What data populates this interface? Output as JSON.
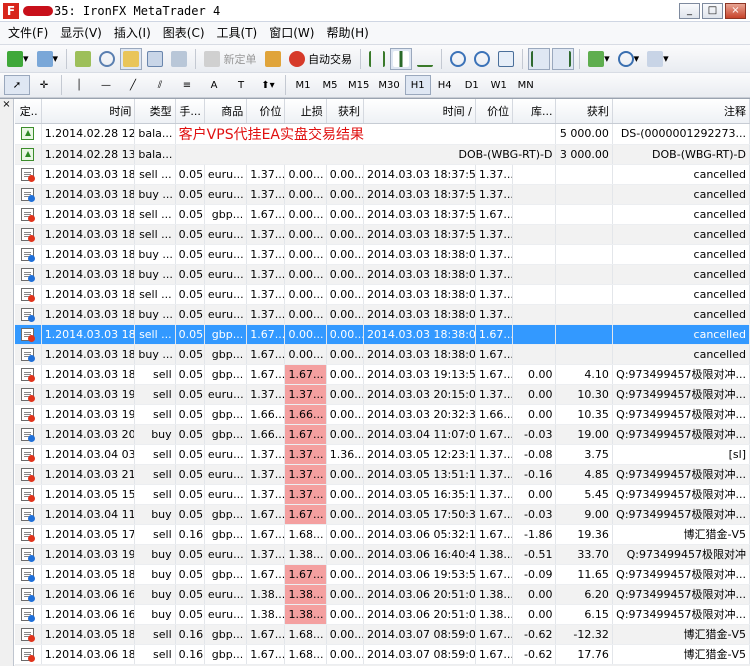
{
  "window": {
    "title": "35: IronFX MetaTrader 4",
    "icon_letter": "F",
    "min_label": "_",
    "max_label": "□",
    "close_label": "×"
  },
  "menu": [
    "文件(F)",
    "显示(V)",
    "插入(I)",
    "图表(C)",
    "工具(T)",
    "窗口(W)",
    "帮助(H)"
  ],
  "toolbar": {
    "new_order_label": "新定单",
    "autotrade_label": "自动交易"
  },
  "timeframes": [
    "M1",
    "M5",
    "M15",
    "M30",
    "H1",
    "H4",
    "D1",
    "W1",
    "MN"
  ],
  "active_timeframe": "H1",
  "side_close_label": "×",
  "table": {
    "headers": [
      "定..",
      "时间",
      "类型",
      "手...",
      "商品",
      "价位",
      "止损",
      "获利",
      "时间 /",
      "价位",
      "库...",
      "获利",
      "注释"
    ],
    "rows": [
      {
        "kind": "dep",
        "c": [
          "",
          "1.2014.02.28 12:...",
          "bala...",
          "",
          "",
          "",
          "",
          "",
          "",
          "",
          "",
          "5 000.00",
          "DS-(0000001292273..."
        ],
        "banner": "客户VPS代挂EA实盘交易结果",
        "banner_right": "DS-(0000001292273 25)-C"
      },
      {
        "kind": "dep",
        "c": [
          "",
          "1.2014.02.28 13:...",
          "bala...",
          "",
          "",
          "",
          "",
          "",
          "",
          "",
          "",
          "3 000.00",
          "DOB-(WBG-RT)-D"
        ],
        "banner": "",
        "banner_right": "DOB-(WBG-RT)-D"
      },
      {
        "kind": "red",
        "c": [
          "",
          "1.2014.03.03 18:...",
          "sell ...",
          "0.05",
          "euru...",
          "1.37...",
          "0.00...",
          "0.00...",
          "2014.03.03 18:37:50",
          "1.37...",
          "",
          "",
          "cancelled"
        ]
      },
      {
        "kind": "blue",
        "c": [
          "",
          "1.2014.03.03 18:...",
          "buy ...",
          "0.05",
          "euru...",
          "1.37...",
          "0.00...",
          "0.00...",
          "2014.03.03 18:37:52",
          "1.37...",
          "",
          "",
          "cancelled"
        ]
      },
      {
        "kind": "red",
        "c": [
          "",
          "1.2014.03.03 18:...",
          "sell ...",
          "0.05",
          "gbp...",
          "1.67...",
          "0.00...",
          "0.00...",
          "2014.03.03 18:37:54",
          "1.67...",
          "",
          "",
          "cancelled"
        ]
      },
      {
        "kind": "red",
        "c": [
          "",
          "1.2014.03.03 18:...",
          "sell ...",
          "0.05",
          "euru...",
          "1.37...",
          "0.00...",
          "0.00...",
          "2014.03.03 18:37:59",
          "1.37...",
          "",
          "",
          "cancelled"
        ]
      },
      {
        "kind": "blue",
        "c": [
          "",
          "1.2014.03.03 18:...",
          "buy ...",
          "0.05",
          "euru...",
          "1.37...",
          "0.00...",
          "0.00...",
          "2014.03.03 18:38:01",
          "1.37...",
          "",
          "",
          "cancelled"
        ]
      },
      {
        "kind": "blue",
        "c": [
          "",
          "1.2014.03.03 18:...",
          "buy ...",
          "0.05",
          "euru...",
          "1.37...",
          "0.00...",
          "0.00...",
          "2014.03.03 18:38:04",
          "1.37...",
          "",
          "",
          "cancelled"
        ]
      },
      {
        "kind": "red",
        "c": [
          "",
          "1.2014.03.03 18:...",
          "sell ...",
          "0.05",
          "euru...",
          "1.37...",
          "0.00...",
          "0.00...",
          "2014.03.03 18:38:05",
          "1.37...",
          "",
          "",
          "cancelled"
        ]
      },
      {
        "kind": "blue",
        "c": [
          "",
          "1.2014.03.03 18:...",
          "buy ...",
          "0.05",
          "euru...",
          "1.37...",
          "0.00...",
          "0.00...",
          "2014.03.03 18:38:06",
          "1.37...",
          "",
          "",
          "cancelled"
        ]
      },
      {
        "kind": "red",
        "sel": true,
        "c": [
          "",
          "1.2014.03.03 18:...",
          "sell ...",
          "0.05",
          "gbp...",
          "1.67...",
          "0.00...",
          "0.00...",
          "2014.03.03 18:38:08",
          "1.67...",
          "",
          "",
          "cancelled"
        ]
      },
      {
        "kind": "blue",
        "c": [
          "",
          "1.2014.03.03 18:...",
          "buy ...",
          "0.05",
          "gbp...",
          "1.67...",
          "0.00...",
          "0.00...",
          "2014.03.03 18:38:09",
          "1.67...",
          "",
          "",
          "cancelled"
        ]
      },
      {
        "kind": "red",
        "sl": true,
        "c": [
          "",
          "1.2014.03.03 18:...",
          "sell",
          "0.05",
          "gbp...",
          "1.67...",
          "1.67...",
          "0.00...",
          "2014.03.03 19:13:57",
          "1.67...",
          "0.00",
          "4.10",
          "Q:973499457极限对冲..."
        ]
      },
      {
        "kind": "red",
        "sl": true,
        "c": [
          "",
          "1.2014.03.03 19:...",
          "sell",
          "0.05",
          "euru...",
          "1.37...",
          "1.37...",
          "0.00...",
          "2014.03.03 20:15:01",
          "1.37...",
          "0.00",
          "10.30",
          "Q:973499457极限对冲..."
        ]
      },
      {
        "kind": "red",
        "sl": true,
        "c": [
          "",
          "1.2014.03.03 19:...",
          "sell",
          "0.05",
          "gbp...",
          "1.66...",
          "1.66...",
          "0.00...",
          "2014.03.03 20:32:31",
          "1.66...",
          "0.00",
          "10.35",
          "Q:973499457极限对冲..."
        ]
      },
      {
        "kind": "blue",
        "sl": true,
        "c": [
          "",
          "1.2014.03.03 20:...",
          "buy",
          "0.05",
          "gbp...",
          "1.66...",
          "1.67...",
          "0.00...",
          "2014.03.04 11:07:06",
          "1.67...",
          "-0.03",
          "19.00",
          "Q:973499457极限对冲..."
        ]
      },
      {
        "kind": "red",
        "sl": true,
        "c": [
          "",
          "1.2014.03.04 03:...",
          "sell",
          "0.05",
          "euru...",
          "1.37...",
          "1.37...",
          "1.36...",
          "2014.03.05 12:23:11",
          "1.37...",
          "-0.08",
          "3.75",
          "[sl]"
        ]
      },
      {
        "kind": "red",
        "sl": true,
        "c": [
          "",
          "1.2014.03.03 21:...",
          "sell",
          "0.05",
          "euru...",
          "1.37...",
          "1.37...",
          "0.00...",
          "2014.03.05 13:51:13",
          "1.37...",
          "-0.16",
          "4.85",
          "Q:973499457极限对冲..."
        ]
      },
      {
        "kind": "red",
        "sl": true,
        "c": [
          "",
          "1.2014.03.05 15:...",
          "sell",
          "0.05",
          "euru...",
          "1.37...",
          "1.37...",
          "0.00...",
          "2014.03.05 16:35:10",
          "1.37...",
          "0.00",
          "5.45",
          "Q:973499457极限对冲..."
        ]
      },
      {
        "kind": "blue",
        "sl": true,
        "c": [
          "",
          "1.2014.03.04 11:...",
          "buy",
          "0.05",
          "gbp...",
          "1.67...",
          "1.67...",
          "0.00...",
          "2014.03.05 17:50:39",
          "1.67...",
          "-0.03",
          "9.00",
          "Q:973499457极限对冲..."
        ]
      },
      {
        "kind": "red",
        "c": [
          "",
          "1.2014.03.05 17:...",
          "sell",
          "0.16",
          "gbp...",
          "1.67...",
          "1.68...",
          "0.00...",
          "2014.03.06 05:32:11",
          "1.67...",
          "-1.86",
          "19.36",
          "博汇猎金-V5"
        ]
      },
      {
        "kind": "blue",
        "c": [
          "",
          "1.2014.03.03 19:...",
          "buy",
          "0.05",
          "euru...",
          "1.37...",
          "1.38...",
          "0.00...",
          "2014.03.06 16:40:42",
          "1.38...",
          "-0.51",
          "33.70",
          "Q:973499457极限对冲"
        ]
      },
      {
        "kind": "blue",
        "sl": true,
        "c": [
          "",
          "1.2014.03.05 18:...",
          "buy",
          "0.05",
          "gbp...",
          "1.67...",
          "1.67...",
          "0.00...",
          "2014.03.06 19:53:55",
          "1.67...",
          "-0.09",
          "11.65",
          "Q:973499457极限对冲..."
        ]
      },
      {
        "kind": "blue",
        "sl": true,
        "c": [
          "",
          "1.2014.03.06 16:...",
          "buy",
          "0.05",
          "euru...",
          "1.38...",
          "1.38...",
          "0.00...",
          "2014.03.06 20:51:06",
          "1.38...",
          "0.00",
          "6.20",
          "Q:973499457极限对冲..."
        ]
      },
      {
        "kind": "blue",
        "sl": true,
        "c": [
          "",
          "1.2014.03.06 16:...",
          "buy",
          "0.05",
          "euru...",
          "1.38...",
          "1.38...",
          "0.00...",
          "2014.03.06 20:51:06",
          "1.38...",
          "0.00",
          "6.15",
          "Q:973499457极限对冲..."
        ]
      },
      {
        "kind": "red",
        "c": [
          "",
          "1.2014.03.05 18:...",
          "sell",
          "0.16",
          "gbp...",
          "1.67...",
          "1.68...",
          "0.00...",
          "2014.03.07 08:59:02",
          "1.67...",
          "-0.62",
          "-12.32",
          "博汇猎金-V5"
        ]
      },
      {
        "kind": "red",
        "c": [
          "",
          "1.2014.03.06 18:...",
          "sell",
          "0.16",
          "gbp...",
          "1.67...",
          "1.68...",
          "0.00...",
          "2014.03.07 08:59:02",
          "1.67...",
          "-0.62",
          "17.76",
          "博汇猎金-V5"
        ]
      }
    ]
  }
}
